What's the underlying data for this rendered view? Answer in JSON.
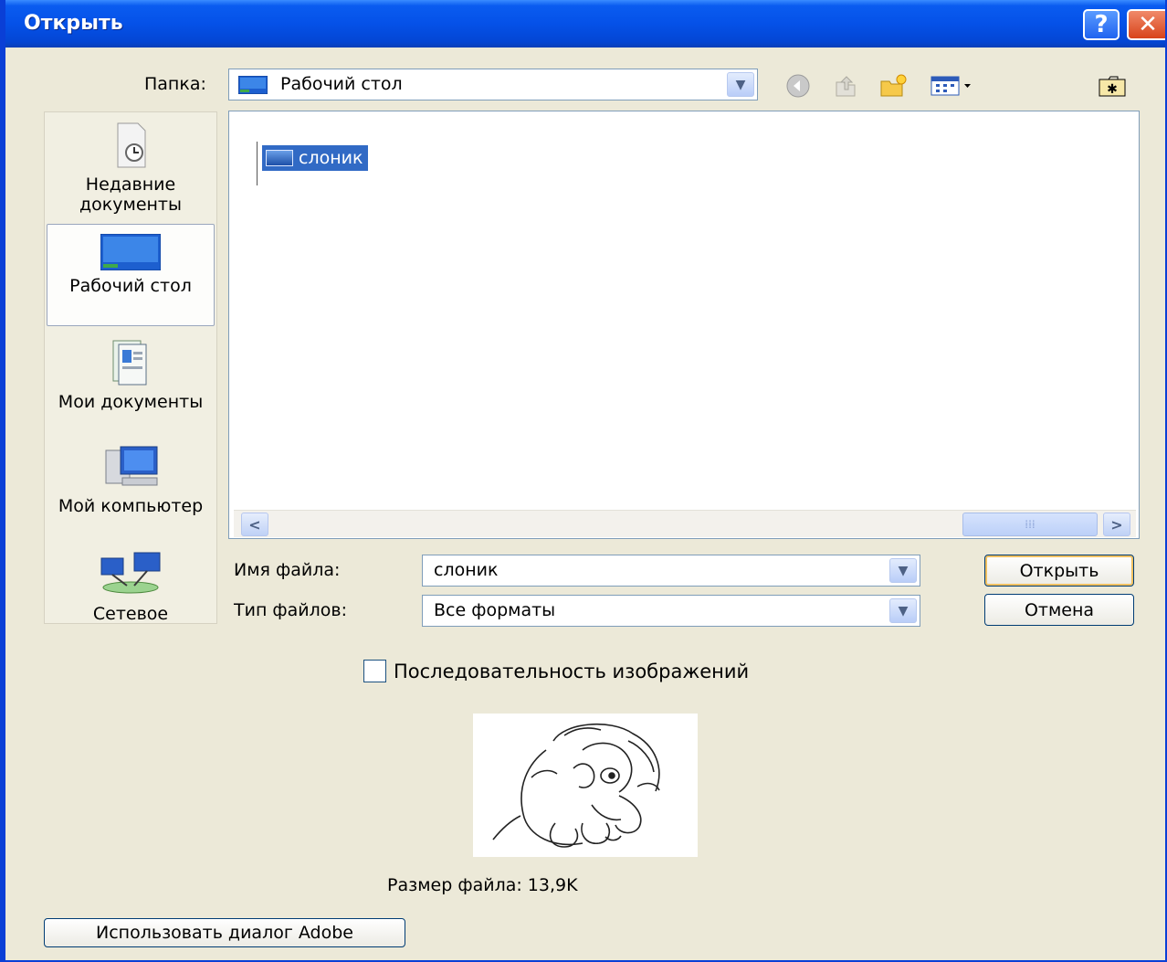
{
  "window": {
    "title": "Открыть",
    "help_glyph": "?",
    "close_glyph": "✕"
  },
  "lookin": {
    "label": "Папка:",
    "value": "Рабочий стол"
  },
  "toolbar": {
    "back_icon": "back-arrow-icon",
    "up_icon": "up-folder-icon",
    "new_folder_icon": "new-folder-icon",
    "views_icon": "views-menu-icon",
    "extra_icon": "open-folder-star-icon"
  },
  "places": [
    {
      "label": "Недавние документы",
      "icon": "recent-documents-icon"
    },
    {
      "label": "Рабочий стол",
      "icon": "desktop-icon",
      "selected": true
    },
    {
      "label": "Мои документы",
      "icon": "my-documents-icon"
    },
    {
      "label": "Мой компьютер",
      "icon": "my-computer-icon"
    },
    {
      "label": "Сетевое",
      "icon": "network-icon"
    }
  ],
  "files": [
    {
      "name": "слоник",
      "selected": true
    }
  ],
  "filename": {
    "label": "Имя файла:",
    "value": "слоник"
  },
  "filetype": {
    "label": "Тип файлов:",
    "value": "Все форматы"
  },
  "buttons": {
    "open": "Открыть",
    "cancel": "Отмена",
    "adobe": "Использовать диалог Adobe"
  },
  "sequence": {
    "label": "Последовательность изображений",
    "checked": false
  },
  "preview": {
    "filesize": "Размер файла: 13,9K"
  }
}
